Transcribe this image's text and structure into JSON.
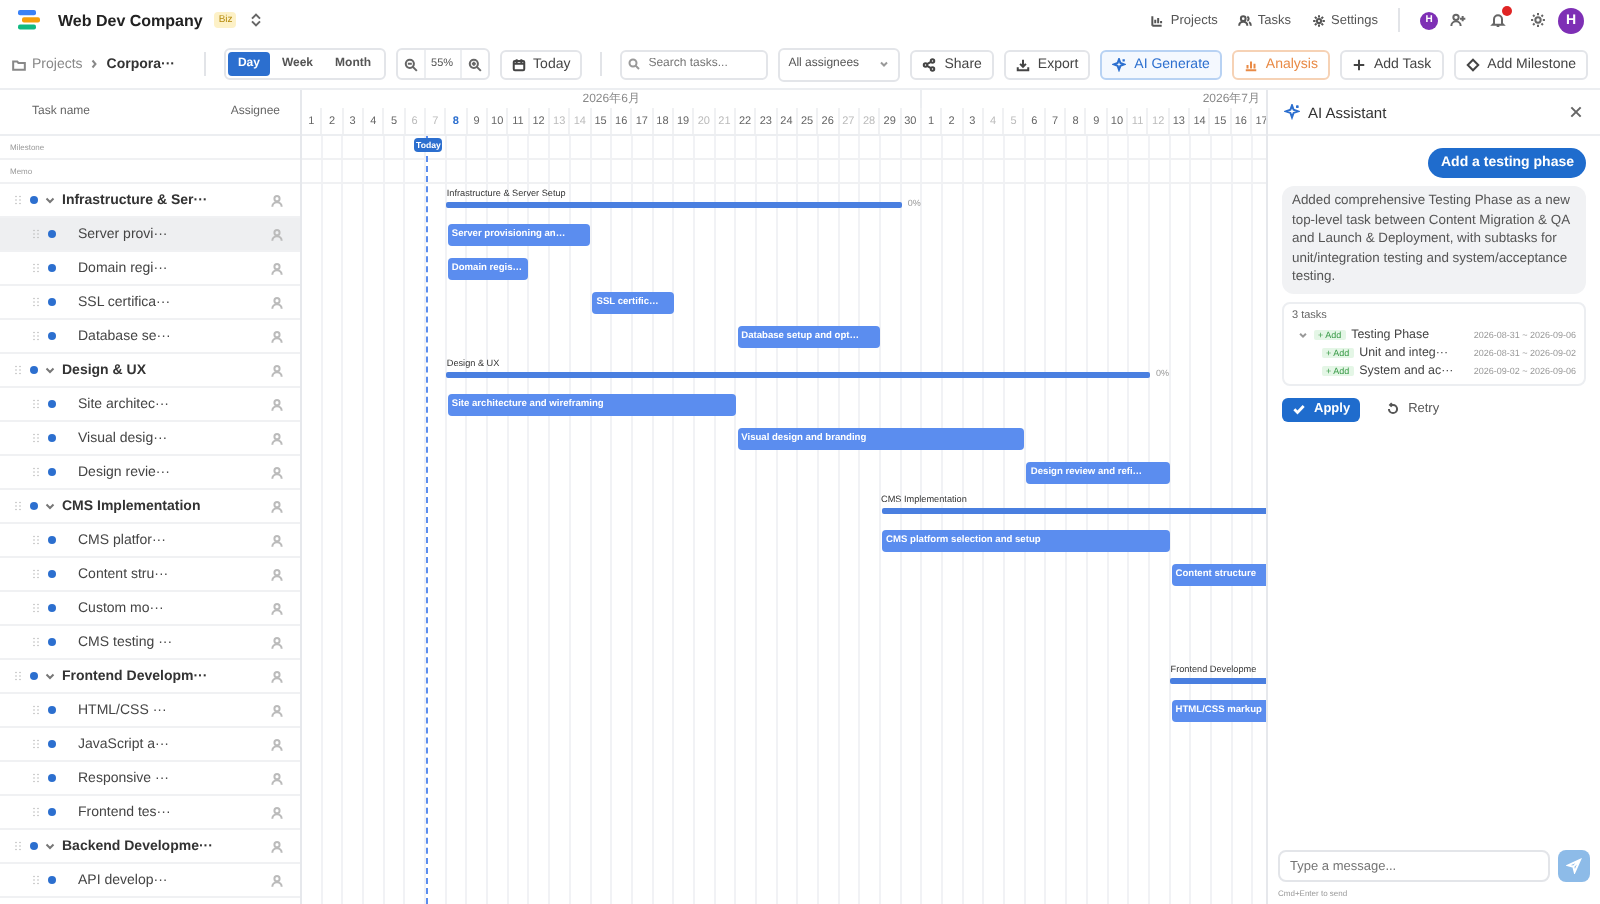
{
  "app": {
    "name": "Web Dev Company",
    "plan": "Biz"
  },
  "nav": [
    {
      "label": "Projects",
      "kind": "projects"
    },
    {
      "label": "Tasks",
      "kind": "tasks"
    },
    {
      "label": "Settings",
      "kind": "settings"
    }
  ],
  "account": {
    "team_initial": "H",
    "user_initial": "H",
    "unread_notifications": true
  },
  "breadcrumb": [
    "Projects",
    "Corpora···"
  ],
  "view_modes": [
    {
      "label": "Day",
      "selected": true
    },
    {
      "label": "Week",
      "selected": false
    },
    {
      "label": "Month",
      "selected": false
    }
  ],
  "zoom": "55%",
  "today_button": "Today",
  "search": {
    "placeholder": "Search tasks..."
  },
  "assignee_filter": "All assignees",
  "actions": [
    {
      "label": "Share",
      "kind": "share"
    },
    {
      "label": "Export",
      "kind": "export"
    },
    {
      "label": "AI Generate",
      "kind": "ai"
    },
    {
      "label": "Analysis",
      "kind": "analysis"
    },
    {
      "label": "Add Task",
      "kind": "add"
    },
    {
      "label": "Add Milestone",
      "kind": "milestone"
    }
  ],
  "task_list": {
    "columns": [
      "Task name",
      "Assignee"
    ],
    "special_rows": [
      "Milestone",
      "Memo"
    ],
    "tasks": [
      {
        "name": "Infrastructure & Ser···",
        "expanded": true,
        "selected": false,
        "bar": {
          "kind": "summary",
          "label": "Infrastructure & Server Setup",
          "progress": "0%"
        },
        "children": [
          {
            "name": "Server provi···",
            "selected": true,
            "bar": {
              "kind": "task",
              "label": "Server provisioning an…"
            }
          },
          {
            "name": "Domain regi···",
            "selected": false,
            "bar": {
              "kind": "task",
              "label": "Domain regis…"
            }
          },
          {
            "name": "SSL certifica···",
            "selected": false,
            "bar": {
              "kind": "task",
              "label": "SSL certific…"
            }
          },
          {
            "name": "Database se···",
            "selected": false,
            "bar": {
              "kind": "task",
              "label": "Database setup and opt…"
            }
          }
        ]
      },
      {
        "name": "Design & UX",
        "expanded": true,
        "selected": false,
        "bar": {
          "kind": "summary",
          "label": "Design & UX",
          "progress": "0%"
        },
        "children": [
          {
            "name": "Site architec···",
            "selected": false,
            "bar": {
              "kind": "task",
              "label": "Site architecture and wireframing"
            }
          },
          {
            "name": "Visual desig···",
            "selected": false,
            "bar": {
              "kind": "task",
              "label": "Visual design and branding"
            }
          },
          {
            "name": "Design revie···",
            "selected": false,
            "bar": {
              "kind": "task",
              "label": "Design review and refi…"
            }
          }
        ]
      },
      {
        "name": "CMS Implementation",
        "expanded": true,
        "selected": false,
        "bar": {
          "kind": "summary",
          "label": "CMS Implementation"
        },
        "children": [
          {
            "name": "CMS platfor···",
            "selected": false,
            "bar": {
              "kind": "task",
              "label": "CMS platform selection and setup"
            }
          },
          {
            "name": "Content stru···",
            "selected": false,
            "bar": {
              "kind": "task",
              "label": "Content structure"
            }
          },
          {
            "name": "Custom mo···",
            "selected": false
          },
          {
            "name": "CMS testing ···",
            "selected": false
          }
        ]
      },
      {
        "name": "Frontend Developm···",
        "expanded": true,
        "selected": false,
        "bar": {
          "kind": "summary",
          "label": "Frontend Developme"
        },
        "children": [
          {
            "name": "HTML/CSS ···",
            "selected": false,
            "bar": {
              "kind": "task",
              "label": "HTML/CSS markup"
            }
          },
          {
            "name": "JavaScript a···",
            "selected": false
          },
          {
            "name": "Responsive ···",
            "selected": false
          },
          {
            "name": "Frontend tes···",
            "selected": false
          }
        ]
      },
      {
        "name": "Backend Developme···",
        "expanded": true,
        "selected": false,
        "children": [
          {
            "name": "API develop···",
            "selected": false
          }
        ]
      }
    ]
  },
  "timeline": {
    "today_marker": "Today",
    "months": [
      {
        "label": "2026年6月"
      },
      {
        "label": "2026年7月"
      }
    ],
    "days": [
      {
        "label": "1",
        "weekend": false,
        "today": false
      },
      {
        "label": "2",
        "weekend": false,
        "today": false
      },
      {
        "label": "3",
        "weekend": false,
        "today": false
      },
      {
        "label": "4",
        "weekend": false,
        "today": false
      },
      {
        "label": "5",
        "weekend": false,
        "today": false
      },
      {
        "label": "6",
        "weekend": true,
        "today": false
      },
      {
        "label": "7",
        "weekend": true,
        "today": false
      },
      {
        "label": "8",
        "weekend": false,
        "today": true
      },
      {
        "label": "9",
        "weekend": false,
        "today": false
      },
      {
        "label": "10",
        "weekend": false,
        "today": false
      },
      {
        "label": "11",
        "weekend": false,
        "today": false
      },
      {
        "label": "12",
        "weekend": false,
        "today": false
      },
      {
        "label": "13",
        "weekend": true,
        "today": false
      },
      {
        "label": "14",
        "weekend": true,
        "today": false
      },
      {
        "label": "15",
        "weekend": false,
        "today": false
      },
      {
        "label": "16",
        "weekend": false,
        "today": false
      },
      {
        "label": "17",
        "weekend": false,
        "today": false
      },
      {
        "label": "18",
        "weekend": false,
        "today": false
      },
      {
        "label": "19",
        "weekend": false,
        "today": false
      },
      {
        "label": "20",
        "weekend": true,
        "today": false
      },
      {
        "label": "21",
        "weekend": true,
        "today": false
      },
      {
        "label": "22",
        "weekend": false,
        "today": false
      },
      {
        "label": "23",
        "weekend": false,
        "today": false
      },
      {
        "label": "24",
        "weekend": false,
        "today": false
      },
      {
        "label": "25",
        "weekend": false,
        "today": false
      },
      {
        "label": "26",
        "weekend": false,
        "today": false
      },
      {
        "label": "27",
        "weekend": true,
        "today": false
      },
      {
        "label": "28",
        "weekend": true,
        "today": false
      },
      {
        "label": "29",
        "weekend": false,
        "today": false
      },
      {
        "label": "30",
        "weekend": false,
        "today": false
      },
      {
        "label": "1",
        "weekend": false,
        "today": false
      },
      {
        "label": "2",
        "weekend": false,
        "today": false
      },
      {
        "label": "3",
        "weekend": false,
        "today": false
      },
      {
        "label": "4",
        "weekend": true,
        "today": false
      },
      {
        "label": "5",
        "weekend": true,
        "today": false
      },
      {
        "label": "6",
        "weekend": false,
        "today": false
      },
      {
        "label": "7",
        "weekend": false,
        "today": false
      },
      {
        "label": "8",
        "weekend": false,
        "today": false
      },
      {
        "label": "9",
        "weekend": false,
        "today": false
      },
      {
        "label": "10",
        "weekend": false,
        "today": false
      },
      {
        "label": "11",
        "weekend": true,
        "today": false
      },
      {
        "label": "12",
        "weekend": true,
        "today": false
      },
      {
        "label": "13",
        "weekend": false,
        "today": false
      },
      {
        "label": "14",
        "weekend": false,
        "today": false
      },
      {
        "label": "15",
        "weekend": false,
        "today": false
      },
      {
        "label": "16",
        "weekend": false,
        "today": false
      },
      {
        "label": "17",
        "weekend": false,
        "today": false
      }
    ]
  },
  "ai_panel": {
    "title": "AI Assistant",
    "messages": [
      {
        "kind": "user",
        "text": "Add a testing phase"
      },
      {
        "kind": "assistant",
        "text": "Added comprehensive Testing Phase as a new top-level task between Content Migration & QA and Launch & Deployment, with subtasks for unit/integration testing and system/acceptance testing.",
        "proposal": {
          "count": "3 tasks",
          "tasks": [
            {
              "badge": "+ Add",
              "name": "Testing Phase",
              "dates": "2026-08-31 ~ 2026-09-06",
              "expanded": true,
              "children": [
                {
                  "badge": "+ Add",
                  "name": "Unit and integ···",
                  "dates": "2026-08-31 ~ 2026-09-02"
                },
                {
                  "badge": "+ Add",
                  "name": "System and ac···",
                  "dates": "2026-09-02 ~ 2026-09-06"
                }
              ]
            }
          ]
        },
        "actions": [
          {
            "label": "Apply",
            "kind": "primary"
          },
          {
            "label": "Retry",
            "kind": "secondary"
          }
        ]
      }
    ],
    "input": {
      "placeholder": "Type a message..."
    },
    "send_disabled": true,
    "hint": "Cmd+Enter to send"
  }
}
